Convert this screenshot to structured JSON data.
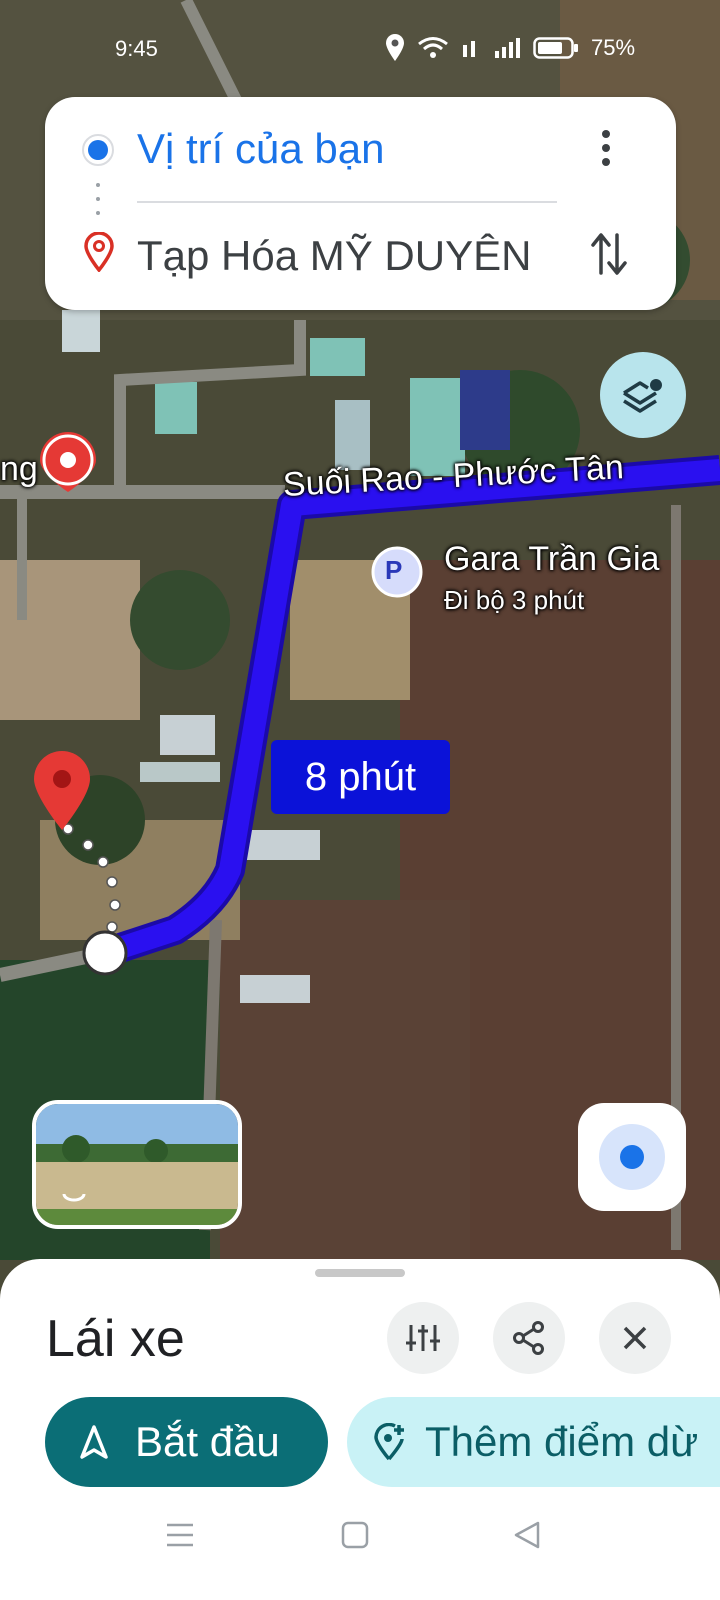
{
  "status_bar": {
    "time": "9:45",
    "battery": "75%"
  },
  "directions": {
    "origin": "Vị trí của bạn",
    "destination": "Tạp Hóa MỸ DUYÊN"
  },
  "map": {
    "left_poi_partial": "ng",
    "street_name": "Suối Rao - Phước Tân",
    "parking_poi": {
      "badge": "P",
      "name": "Gara Trần Gia",
      "walk": "Đi bộ 3 phút"
    },
    "eta": "8 phút"
  },
  "bottom_sheet": {
    "mode": "Lái xe",
    "start_label": "Bắt đầu",
    "add_stop_label": "Thêm điểm dừ"
  },
  "colors": {
    "route": "#2a10f0",
    "accent": "#1a73e8",
    "primary_button": "#0b6e76",
    "destination_pin": "#e53935"
  },
  "icons": [
    "more-vert-icon",
    "swap-icon",
    "layers-icon",
    "my-location-icon",
    "tune-icon",
    "share-icon",
    "close-icon",
    "navigation-arrow-icon",
    "add-location-icon"
  ]
}
